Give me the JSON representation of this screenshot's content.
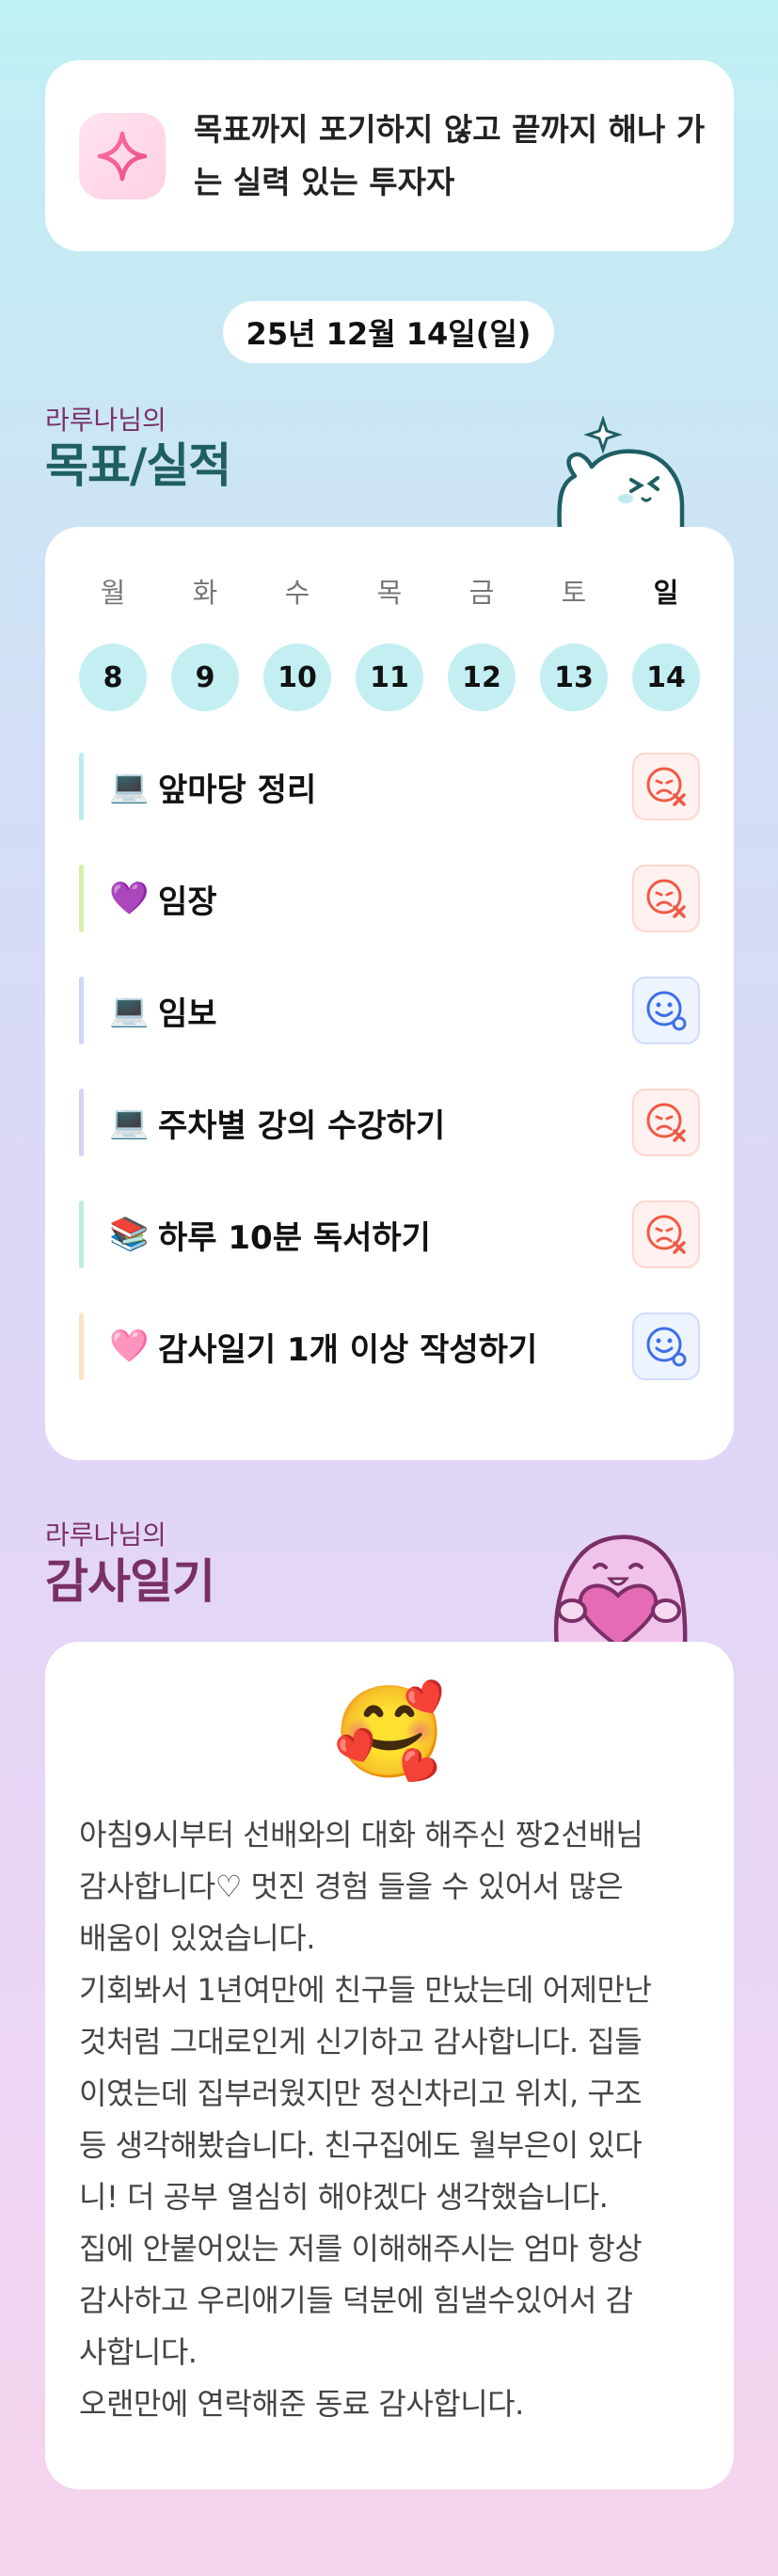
{
  "motto": {
    "icon": "sparkle-icon",
    "text": "목표까지 포기하지 않고 끝까지 해나 가는 실력 있는 투자자"
  },
  "date": "25년 12월 14일(일)",
  "goals_section": {
    "subtitle": "라루나님의",
    "title": "목표/실적"
  },
  "week": {
    "days": [
      {
        "name": "월",
        "num": "8"
      },
      {
        "name": "화",
        "num": "9"
      },
      {
        "name": "수",
        "num": "10"
      },
      {
        "name": "목",
        "num": "11"
      },
      {
        "name": "금",
        "num": "12"
      },
      {
        "name": "토",
        "num": "13"
      },
      {
        "name": "일",
        "num": "14"
      }
    ]
  },
  "goals": [
    {
      "emoji": "💻",
      "text": "앞마당 정리",
      "status": "fail",
      "bar_color": "#b8ecf0"
    },
    {
      "emoji": "💜",
      "text": "임장",
      "status": "fail",
      "bar_color": "#d6f0a8"
    },
    {
      "emoji": "💻",
      "text": "임보",
      "status": "done",
      "bar_color": "#cfd6f6"
    },
    {
      "emoji": "💻",
      "text": "주차별 강의 수강하기",
      "status": "fail",
      "bar_color": "#d7d2f4"
    },
    {
      "emoji": "📚",
      "text": "하루 10분 독서하기",
      "status": "fail",
      "bar_color": "#bdeed6"
    },
    {
      "emoji": "🩷",
      "text": "감사일기 1개 이상 작성하기",
      "status": "done",
      "bar_color": "#fbe3c4"
    }
  ],
  "diary_section": {
    "subtitle": "라루나님의",
    "title": "감사일기"
  },
  "diary": {
    "emoji": "🥰",
    "text": "아침9시부터 선배와의 대화 해주신 짱2선배님\n감사합니다♡ 멋진 경험 들을 수 있어서 많은\n배움이 있었습니다.\n기회봐서 1년여만에 친구들 만났는데 어제만난\n것처럼 그대로인게 신기하고 감사합니다. 집들\n이였는데 집부러웠지만 정신차리고 위치, 구조\n등 생각해봤습니다. 친구집에도 월부은이 있다\n니! 더 공부 열심히 해야겠다 생각했습니다.\n집에 안붙어있는 저를 이해해주시는 엄마 항상\n감사하고 우리애기들 덕분에 힘낼수있어서 감\n사합니다.\n오랜만에 연락해준 동료 감사합니다."
  },
  "colors": {
    "accent_pink": "#7a2f68",
    "fail_red": "#ef5a45",
    "done_blue": "#3d6fe8",
    "day_circle": "#c3eff2"
  }
}
